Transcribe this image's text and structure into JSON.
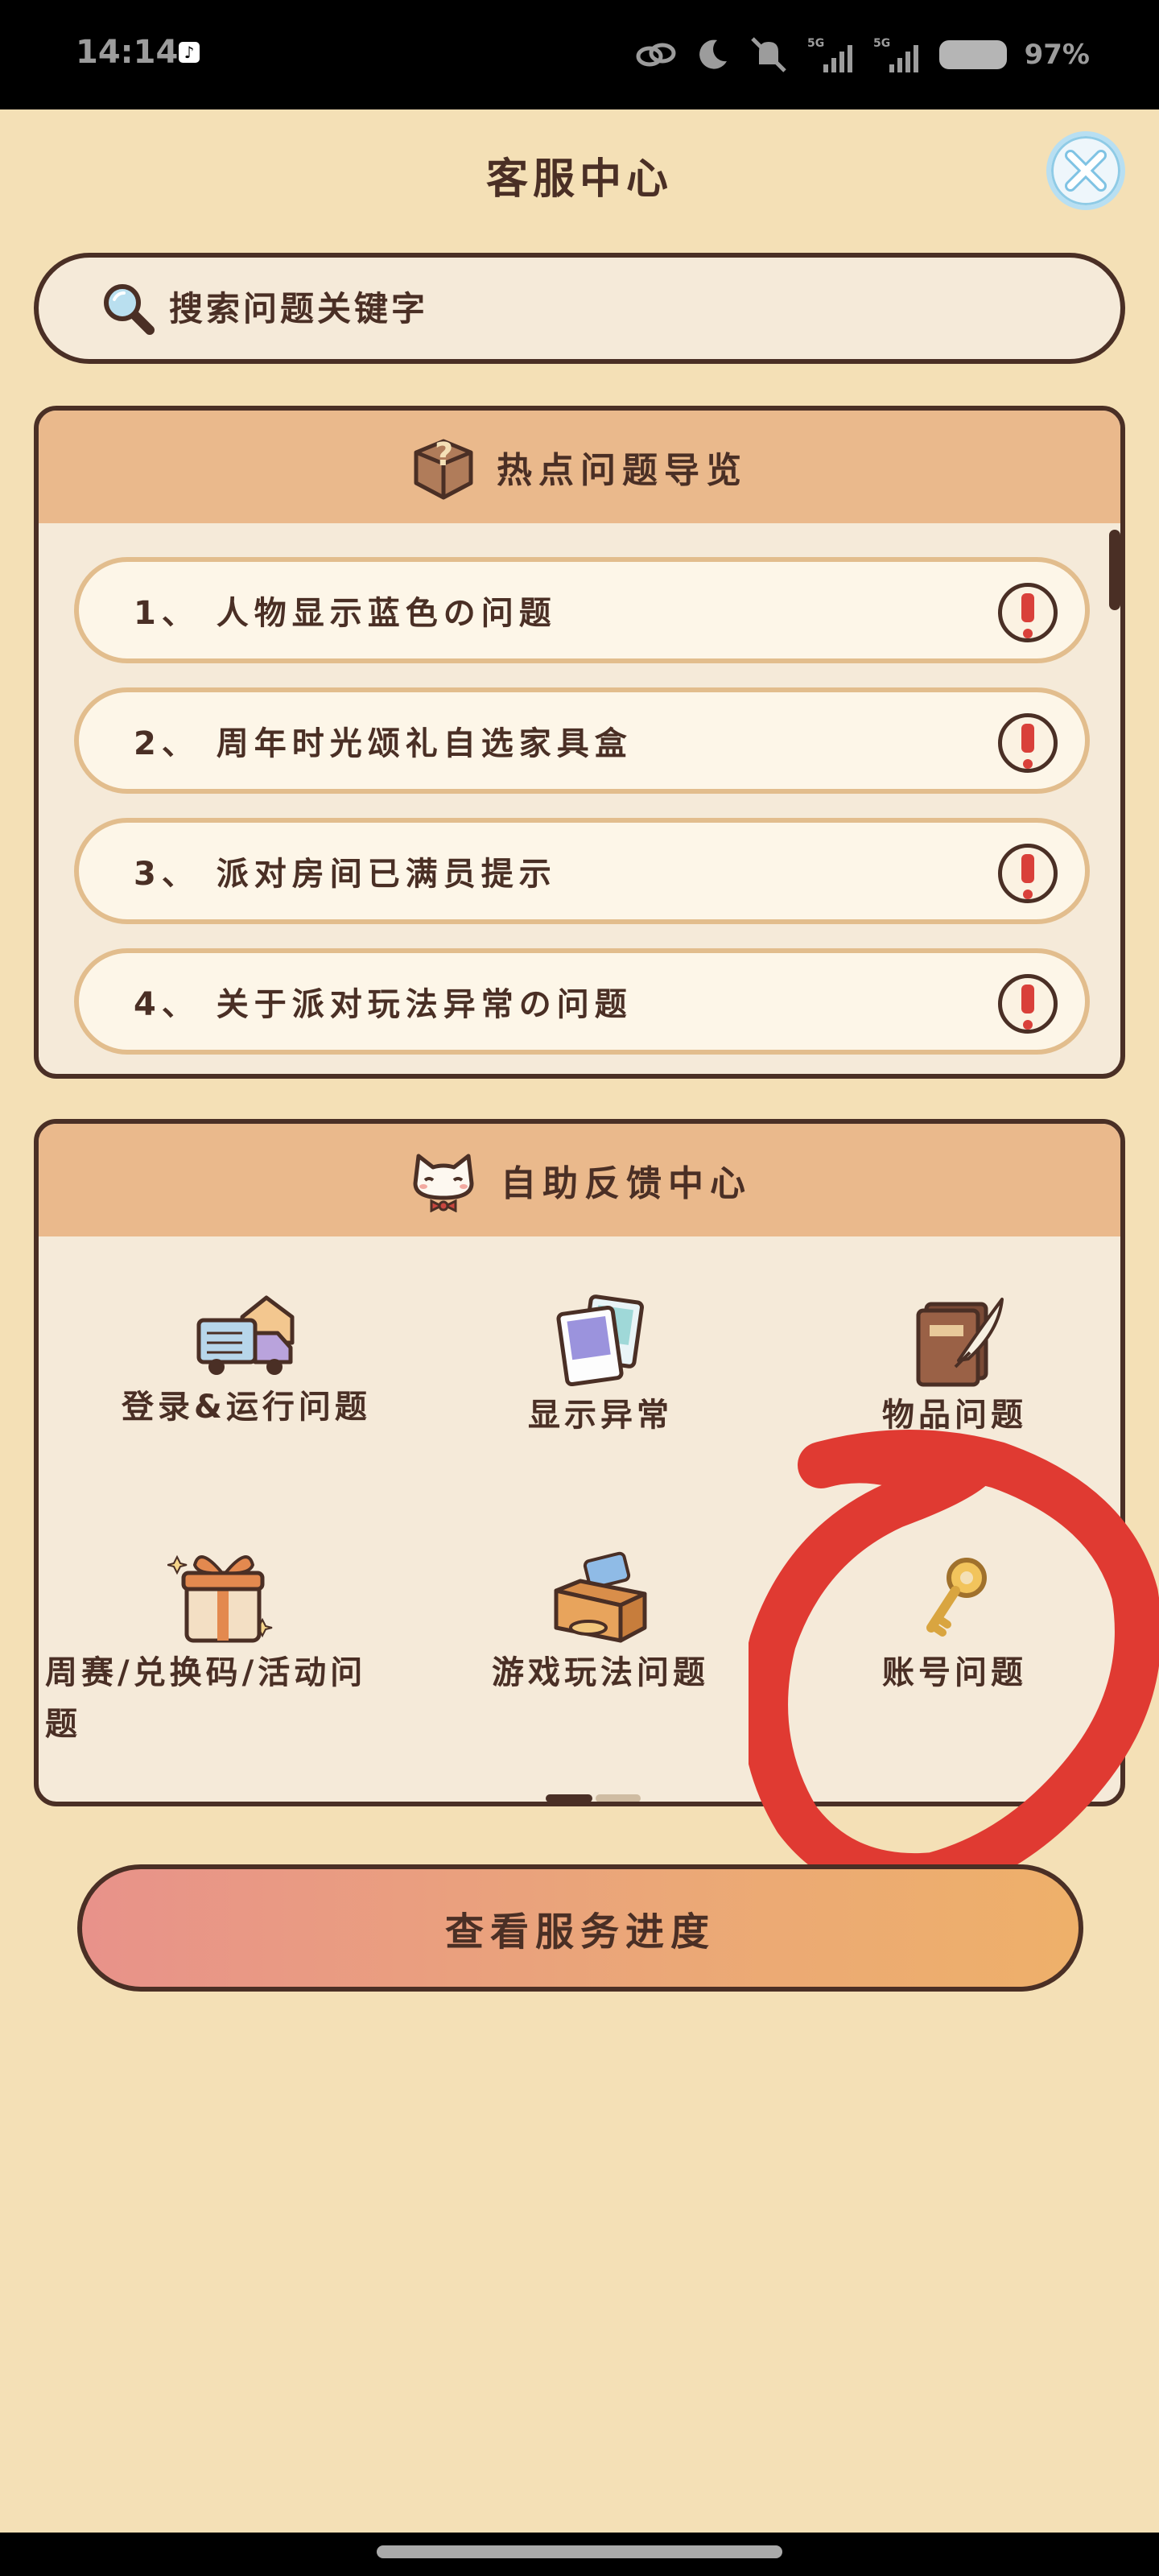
{
  "status_bar": {
    "time": "14:14",
    "app_badge": "♪",
    "battery_text": "97%",
    "network_labels": [
      "5G",
      "5G"
    ]
  },
  "header": {
    "title": "客服中心",
    "close_icon": "close-icon"
  },
  "search": {
    "placeholder": "搜索问题关键字",
    "value": "",
    "icon": "magnifier-icon"
  },
  "hot_panel": {
    "title": "热点问题导览",
    "icon": "question-box-icon",
    "items": [
      {
        "label": "1、 人物显示蓝色の问题"
      },
      {
        "label": "2、 周年时光颂礼自选家具盒"
      },
      {
        "label": "3、 派对房间已满员提示"
      },
      {
        "label": "4、 关于派对玩法异常の问题"
      }
    ]
  },
  "self_help": {
    "title": "自助反馈中心",
    "icon": "cat-icon",
    "items": [
      {
        "label": "登录&运行问题",
        "icon": "truck-icon"
      },
      {
        "label": "显示异常",
        "icon": "photos-icon"
      },
      {
        "label": "物品问题",
        "icon": "book-quill-icon"
      },
      {
        "label": "周赛/兑换码/活动问题",
        "icon": "gift-icon"
      },
      {
        "label": "游戏玩法问题",
        "icon": "box-icon"
      },
      {
        "label": "账号问题",
        "icon": "key-icon"
      }
    ],
    "page_indicator": {
      "current": 1,
      "total": 2
    }
  },
  "footer_button": {
    "label": "查看服务进度"
  },
  "colors": {
    "background": "#f4e0b6",
    "dark_brown": "#4a2f25",
    "header_orange": "#eab98c",
    "alert_red": "#d9403a",
    "annotation_red": "#e03a32"
  }
}
